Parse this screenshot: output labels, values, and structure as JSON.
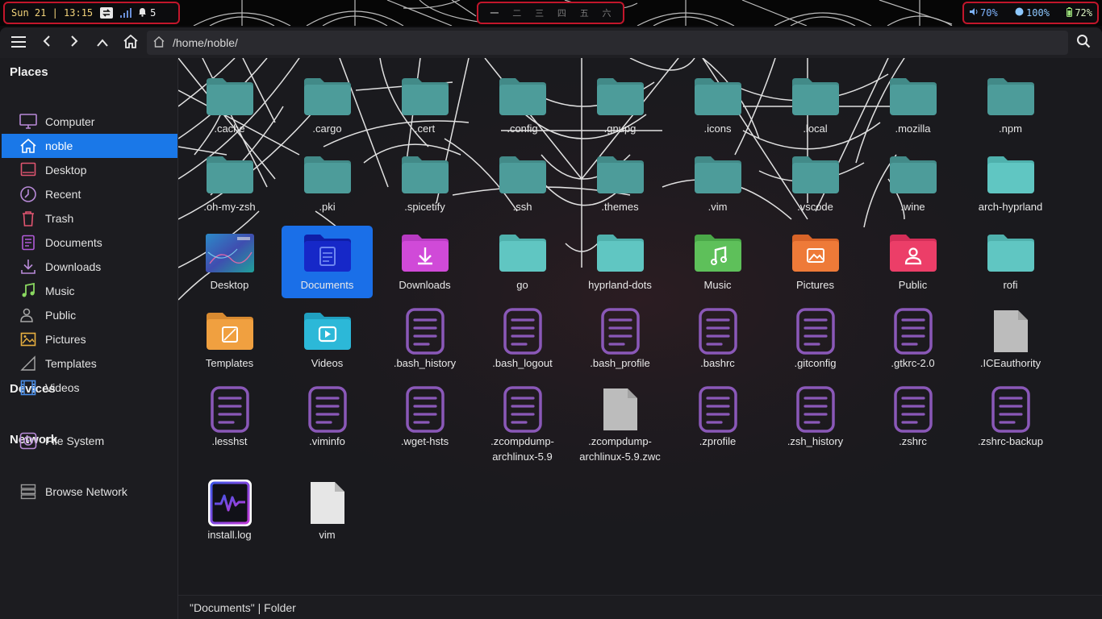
{
  "topbar": {
    "clock": "Sun 21 | 13:15",
    "notifications": "5",
    "workspaces": [
      "一",
      "二",
      "三",
      "四",
      "五",
      "六"
    ],
    "active_workspace_index": 0,
    "volume": "70%",
    "brightness": "100%",
    "battery": "72%"
  },
  "toolbar": {
    "path": "/home/noble/"
  },
  "sidebar": {
    "places_title": "Places",
    "places": [
      {
        "label": "Computer",
        "icon": "computer-icon"
      },
      {
        "label": "noble",
        "icon": "home-icon",
        "selected": true
      },
      {
        "label": "Desktop",
        "icon": "desktop-icon"
      },
      {
        "label": "Recent",
        "icon": "recent-icon"
      },
      {
        "label": "Trash",
        "icon": "trash-icon"
      },
      {
        "label": "Documents",
        "icon": "documents-icon"
      },
      {
        "label": "Downloads",
        "icon": "downloads-icon"
      },
      {
        "label": "Music",
        "icon": "music-icon"
      },
      {
        "label": "Public",
        "icon": "public-icon"
      },
      {
        "label": "Pictures",
        "icon": "pictures-icon"
      },
      {
        "label": "Templates",
        "icon": "templates-icon"
      },
      {
        "label": "Videos",
        "icon": "videos-icon"
      }
    ],
    "devices_title": "Devices",
    "devices": [
      {
        "label": "File System",
        "icon": "drive-icon"
      }
    ],
    "network_title": "Network",
    "network": [
      {
        "label": "Browse Network",
        "icon": "network-icon"
      }
    ]
  },
  "files": [
    {
      "name": ".cache",
      "type": "folder-hidden"
    },
    {
      "name": ".cargo",
      "type": "folder-hidden"
    },
    {
      "name": ".cert",
      "type": "folder-hidden"
    },
    {
      "name": ".config",
      "type": "folder-hidden"
    },
    {
      "name": ".gnupg",
      "type": "folder-hidden"
    },
    {
      "name": ".icons",
      "type": "folder-hidden"
    },
    {
      "name": ".local",
      "type": "folder-hidden"
    },
    {
      "name": ".mozilla",
      "type": "folder-hidden"
    },
    {
      "name": ".npm",
      "type": "folder-hidden"
    },
    {
      "name": ".oh-my-zsh",
      "type": "folder-hidden"
    },
    {
      "name": ".pki",
      "type": "folder-hidden"
    },
    {
      "name": ".spicetify",
      "type": "folder-hidden"
    },
    {
      "name": ".ssh",
      "type": "folder-hidden"
    },
    {
      "name": ".themes",
      "type": "folder-hidden"
    },
    {
      "name": ".vim",
      "type": "folder-hidden"
    },
    {
      "name": ".vscode",
      "type": "folder-hidden"
    },
    {
      "name": ".wine",
      "type": "folder-hidden"
    },
    {
      "name": "arch-hyprland",
      "type": "folder"
    },
    {
      "name": "Desktop",
      "type": "desktop"
    },
    {
      "name": "Documents",
      "type": "documents",
      "selected": true
    },
    {
      "name": "Downloads",
      "type": "downloads"
    },
    {
      "name": "go",
      "type": "folder"
    },
    {
      "name": "hyprland-dots",
      "type": "folder"
    },
    {
      "name": "Music",
      "type": "music"
    },
    {
      "name": "Pictures",
      "type": "pictures"
    },
    {
      "name": "Public",
      "type": "public"
    },
    {
      "name": "rofi",
      "type": "folder"
    },
    {
      "name": "Templates",
      "type": "templates"
    },
    {
      "name": "Videos",
      "type": "videos"
    },
    {
      "name": ".bash_history",
      "type": "text"
    },
    {
      "name": ".bash_logout",
      "type": "text"
    },
    {
      "name": ".bash_profile",
      "type": "text"
    },
    {
      "name": ".bashrc",
      "type": "text"
    },
    {
      "name": ".gitconfig",
      "type": "text"
    },
    {
      "name": ".gtkrc-2.0",
      "type": "text"
    },
    {
      "name": ".ICEauthority",
      "type": "blank"
    },
    {
      "name": ".lesshst",
      "type": "text"
    },
    {
      "name": ".viminfo",
      "type": "text"
    },
    {
      "name": ".wget-hsts",
      "type": "text"
    },
    {
      "name": ".zcompdump-\narchlinux-5.9",
      "type": "text"
    },
    {
      "name": ".zcompdump-\narchlinux-5.9.zwc",
      "type": "blank"
    },
    {
      "name": ".zprofile",
      "type": "text"
    },
    {
      "name": ".zsh_history",
      "type": "text"
    },
    {
      "name": ".zshrc",
      "type": "text"
    },
    {
      "name": ".zshrc-backup",
      "type": "text"
    },
    {
      "name": "install.log",
      "type": "log"
    },
    {
      "name": "vim",
      "type": "white"
    }
  ],
  "statusbar": {
    "text": "\"Documents\"  |  Folder"
  },
  "colors": {
    "accent": "#1a78e8",
    "topbar_border": "#c2162b",
    "folder_teal": "#5bc2c0",
    "text_doc_purple": "#8a58b8"
  }
}
